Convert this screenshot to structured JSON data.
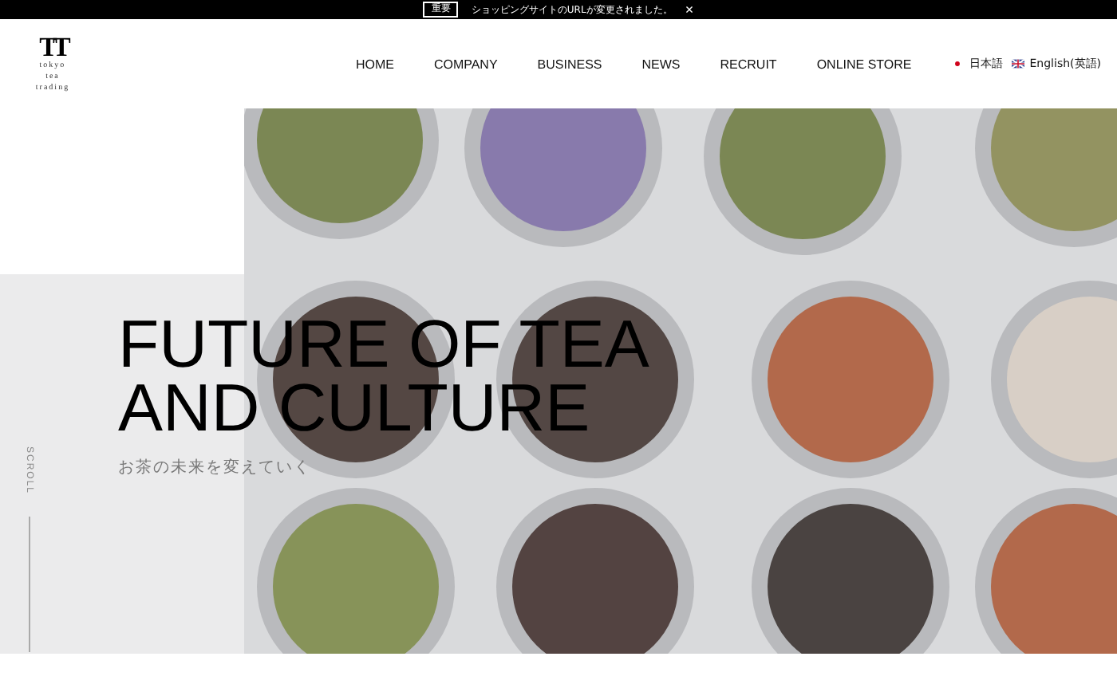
{
  "notice_bar": {
    "badge": "重要",
    "message": "ショッピングサイトのURLが変更されました。",
    "close": "×"
  },
  "logo": {
    "mark": "TT",
    "lines": [
      "tokyo",
      "tea",
      "trading"
    ]
  },
  "nav": [
    {
      "label": "HOME"
    },
    {
      "label": "COMPANY"
    },
    {
      "label": "BUSINESS"
    },
    {
      "label": "NEWS"
    },
    {
      "label": "RECRUIT"
    },
    {
      "label": "ONLINE STORE"
    }
  ],
  "languages": [
    {
      "kind": "jp",
      "label": "日本語"
    },
    {
      "kind": "uk",
      "label": "English(英語)"
    }
  ],
  "hero": {
    "headline": [
      "FUTURE OF TEA",
      "AND CULTURE"
    ],
    "subtitle": "お茶の未来を変えていく",
    "scroll": "SCROLL"
  }
}
